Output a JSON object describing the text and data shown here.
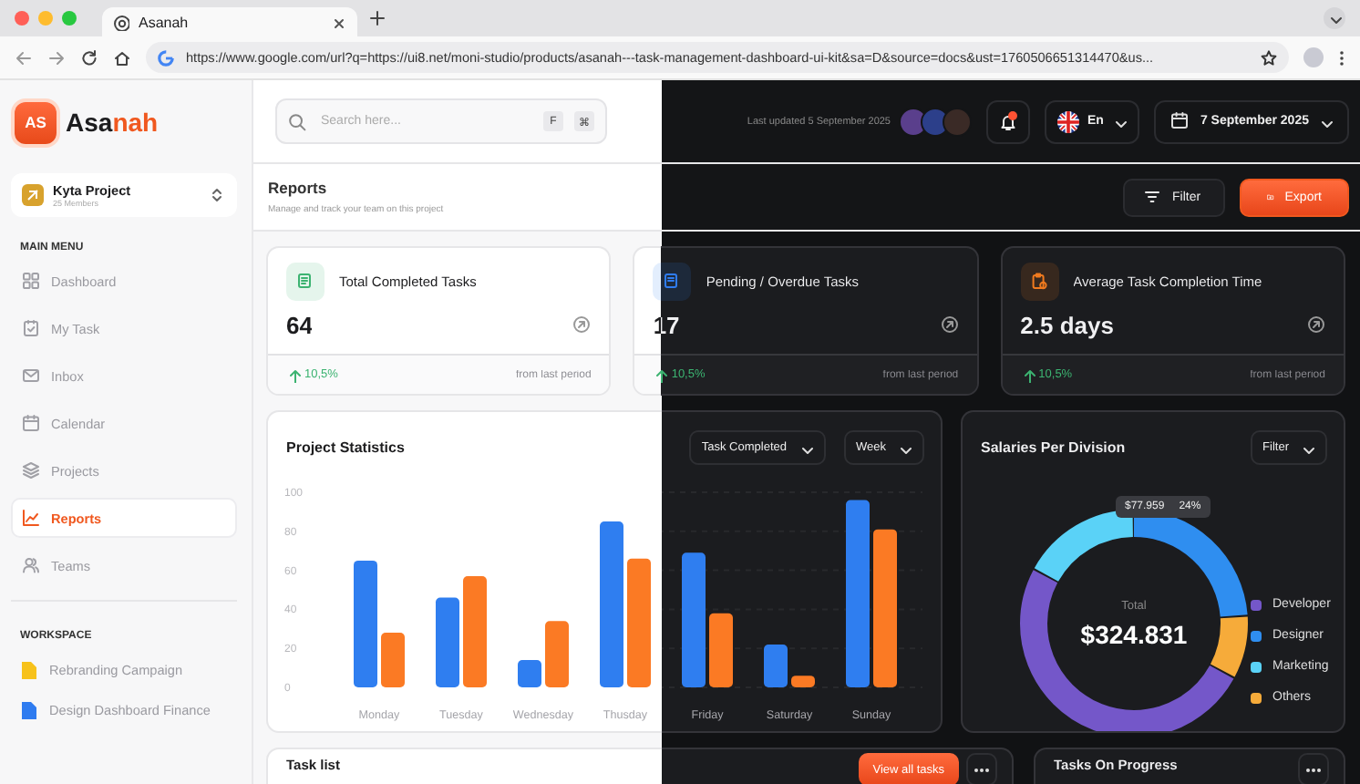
{
  "browser": {
    "tab_title": "Asanah",
    "url": "https://www.google.com/url?q=https://ui8.net/moni-studio/products/asanah---task-management-dashboard-ui-kit&sa=D&source=docs&ust=1760506651314470&us..."
  },
  "brand": {
    "mark": "AS",
    "name": "Asa",
    "name_accent": "nah"
  },
  "project": {
    "name": "Kyta Project",
    "members": "25 Members"
  },
  "sidebar": {
    "main_menu_label": "MAIN MENU",
    "items": [
      {
        "label": "Dashboard",
        "selected": false
      },
      {
        "label": "My Task",
        "selected": false
      },
      {
        "label": "Inbox",
        "selected": false
      },
      {
        "label": "Calendar",
        "selected": false
      },
      {
        "label": "Projects",
        "selected": false
      },
      {
        "label": "Reports",
        "selected": true
      },
      {
        "label": "Teams",
        "selected": false
      }
    ],
    "workspace_label": "WORKSPACE",
    "workspace_items": [
      {
        "label": "Rebranding Campaign",
        "color": "#f7c21b"
      },
      {
        "label": "Design Dashboard Finance",
        "color": "#2f7cf0"
      }
    ]
  },
  "header": {
    "search_placeholder": "Search here...",
    "shortcut_keys": [
      "F",
      "⌘"
    ],
    "last_updated": "Last updated 5 September 2025",
    "notifications_unread": true,
    "language": "En",
    "date": "7 September 2025"
  },
  "page": {
    "title": "Reports",
    "subtitle": "Manage and track your team on this project",
    "buttons": [
      {
        "label": "Filter",
        "kind": "secondary"
      },
      {
        "label": "Export",
        "kind": "primary"
      }
    ]
  },
  "stats": [
    {
      "title": "Total Completed Tasks",
      "value": "64",
      "change": "10,5%",
      "note": "from last period",
      "color": "#3cb371"
    },
    {
      "title": "Pending / Overdue Tasks",
      "value": "17",
      "change": "10,5%",
      "note": "from last period",
      "color": "#2f7cf0"
    },
    {
      "title": "Average Task Completion Time",
      "value": "2.5 days",
      "change": "10,5%",
      "note": "from last period",
      "color": "#f07a1e"
    }
  ],
  "project_statistics": {
    "title": "Project Statistics",
    "filters": [
      "Task Completed",
      "Week"
    ],
    "chart_data": {
      "type": "bar",
      "categories": [
        "Monday",
        "Tuesday",
        "Wednesday",
        "Thusday",
        "Friday",
        "Saturday",
        "Sunday"
      ],
      "series": [
        {
          "color": "#2f7ef0",
          "values": [
            65,
            46,
            14,
            85,
            69,
            22,
            96
          ]
        },
        {
          "color": "#fb7a24",
          "values": [
            28,
            57,
            34,
            66,
            38,
            6,
            81
          ]
        }
      ],
      "ylim": [
        0,
        100
      ],
      "yticks": [
        0,
        20,
        40,
        60,
        80,
        100
      ],
      "grid": true
    }
  },
  "salaries": {
    "title": "Salaries Per Division",
    "filter": "Filter",
    "total_label": "Total",
    "total": "$324.831",
    "tooltip": {
      "amount": "$77.959",
      "share": "24%"
    },
    "legend": [
      {
        "label": "Developer",
        "color": "#7457c9"
      },
      {
        "label": "Designer",
        "color": "#2f8ef0"
      },
      {
        "label": "Marketing",
        "color": "#5ad2f7"
      },
      {
        "label": "Others",
        "color": "#f6ab3a"
      }
    ]
  },
  "task_list": {
    "title": "Task list",
    "button": "View all tasks"
  },
  "tasks_on_progress": {
    "title": "Tasks On Progress"
  }
}
